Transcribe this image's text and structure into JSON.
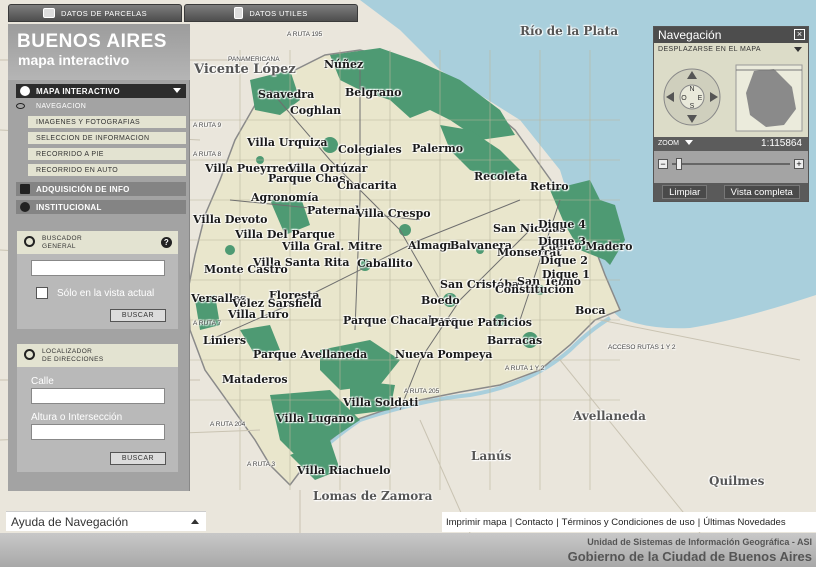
{
  "top_tabs": [
    {
      "label": "DATOS DE PARCELAS",
      "icon": "camera-icon"
    },
    {
      "label": "DATOS UTILES",
      "icon": "document-icon"
    }
  ],
  "brand": {
    "title": "BUENOS AIRES",
    "subtitle": "mapa interactivo"
  },
  "sidebar": {
    "sections": [
      {
        "label": "MAPA INTERACTIVO",
        "icon": "globe-icon"
      },
      {
        "label": "ADQUISICIÓN DE INFO",
        "icon": "cart-icon"
      },
      {
        "label": "INSTITUCIONAL",
        "icon": "info-icon"
      }
    ],
    "items": [
      {
        "label": "NAVEGACION"
      },
      {
        "label": "IMAGENES Y FOTOGRAFIAS"
      },
      {
        "label": "SELECCION DE INFORMACION"
      },
      {
        "label": "RECORRIDO A PIE"
      },
      {
        "label": "RECORRIDO EN AUTO"
      }
    ]
  },
  "search": {
    "title_line1": "BUSCADOR",
    "title_line2": "GENERAL",
    "value": "",
    "checkbox_label": "Sólo en la vista actual",
    "button": "BUSCAR"
  },
  "locator": {
    "title_line1": "LOCALIZADOR",
    "title_line2": "DE DIRECCIONES",
    "street_label": "Calle",
    "height_label": "Altura o Intersección",
    "button": "BUSCAR"
  },
  "nav_widget": {
    "title": "Navegación",
    "mode": "DESPLAZARSE EN EL MAPA",
    "zoom_label": "ZOOM",
    "scale": "1:115864",
    "compass": [
      "N",
      "S",
      "E",
      "O"
    ],
    "clear_button": "Limpiar",
    "full_view_button": "Vista completa"
  },
  "help_bar": {
    "label": "Ayuda de Navegación"
  },
  "footer_links": [
    "Imprimir mapa",
    "Contacto",
    "Términos y Condiciones de uso",
    "Últimas Novedades"
  ],
  "footer": {
    "line1": "Unidad de Sistemas de Información Geográfica - ASI",
    "line2": "Gobierno de la Ciudad de Buenos Aires"
  },
  "map": {
    "neighborhoods": [
      "Núñez",
      "Saavedra",
      "Belgrano",
      "Coghlan",
      "Villa Urquiza",
      "Colegiales",
      "Palermo",
      "Villa Pueyrredón",
      "Villa Ortúzar",
      "Parque Chas",
      "Chacarita",
      "Recoleta",
      "Retiro",
      "Agronomía",
      "Paternal",
      "Villa Crespo",
      "Villa Devoto",
      "Villa Del Parque",
      "Villa Gral. Mitre",
      "Almagro",
      "Balvanera",
      "San Nicolás",
      "Monserrat",
      "Villa Santa Rita",
      "Caballito",
      "Monte Castro",
      "Floresta",
      "San Cristóbal",
      "San Telmo",
      "Constitución",
      "Versalles",
      "Vélez Sarsfield",
      "Villa Luro",
      "Boedo",
      "Parque Chacabuco",
      "Parque Patricios",
      "Boca",
      "Barracas",
      "Liniers",
      "Parque Avellaneda",
      "Nueva Pompeya",
      "Mataderos",
      "Villa Soldati",
      "Villa Lugano",
      "Villa Riachuelo",
      "Puerto Madero",
      "Dique 4",
      "Dique 3",
      "Dique 2",
      "Dique 1"
    ],
    "outside_labels": [
      "Vicente López",
      "Río de la Plata",
      "Avellaneda",
      "Lanús",
      "Lomas de Zamora",
      "Quilmes"
    ],
    "road_labels": [
      "A RUTA 195",
      "A RUTA 9",
      "A RUTA 8",
      "A RUTA 7",
      "A RUTA 204",
      "A RUTA 3",
      "A RUTA 205",
      "A RUTA 1 Y 2",
      "ACCESO RUTAS 1 Y 2",
      "PANAMERICANA"
    ],
    "colors": {
      "water": "#a9cfdc",
      "city": "#e9e6cc",
      "parks": "#4e9a73",
      "outside": "#eae6dc",
      "border": "#8a8a8a"
    }
  }
}
